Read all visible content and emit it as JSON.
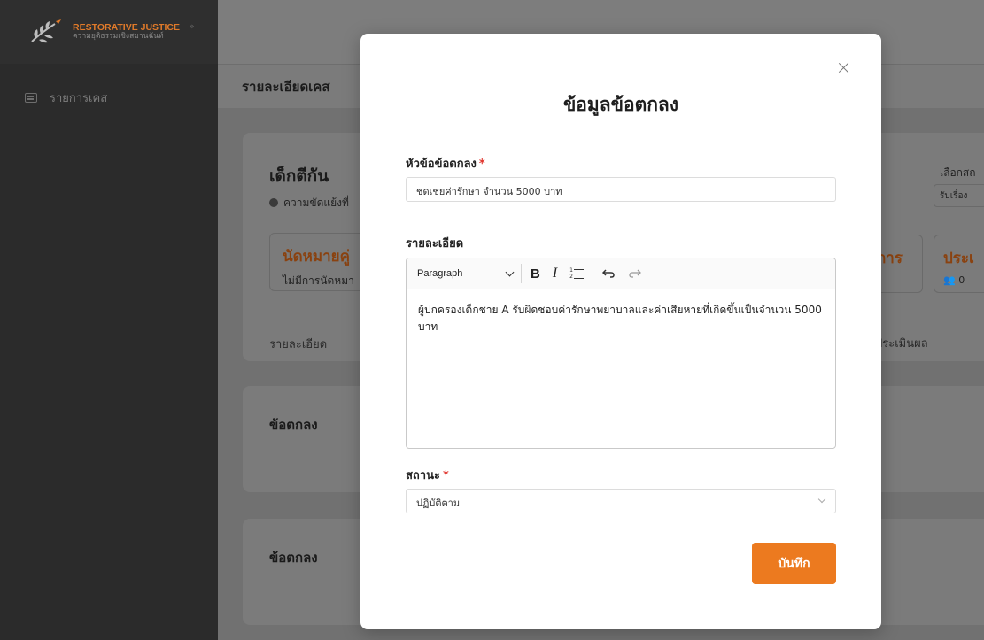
{
  "sidebar": {
    "logo": {
      "title": "RESTORATIVE JUSTICE",
      "subtitle": "ความยุติธรรมเชิงสมานฉันท์"
    },
    "items": [
      {
        "label": "รายการเคส",
        "icon": "list-icon"
      }
    ]
  },
  "header": {
    "page_title": "รายละเอียดเคส"
  },
  "background": {
    "case_title": "เด็กตีกัน",
    "case_subtitle": "ความขัดแย้งที่",
    "appointment_title": "นัดหมายคู่",
    "appointment_sub": "ไม่มีการนัดหมา",
    "detail_tab": "รายละเอียด",
    "agreement_title_1": "ข้อตกลง",
    "agreement_title_2": "ข้อตกลง",
    "right_select_label": "เลือกสถ",
    "right_select_value": "รับเรื่อง",
    "right_box_1": "การ",
    "right_box_2_title": "ประเ",
    "right_box_2_count": "0",
    "right_tab": "ประเมินผล"
  },
  "modal": {
    "title": "ข้อมูลข้อตกลง",
    "topic_label": "หัวข้อข้อตกลง",
    "required_mark": "*",
    "topic_value": "ชดเชยค่ารักษา จำนวน 5000 บาท",
    "detail_label": "รายละเอียด",
    "editor": {
      "format": "Paragraph",
      "bold": "B",
      "italic": "I",
      "content": "ผู้ปกครองเด็กชาย A รับผิดชอบค่ารักษาพยาบาลและค่าเสียหายที่เกิดขึ้นเป็นจำนวน 5000 บาท"
    },
    "status_label": "สถานะ",
    "status_value": "ปฏิบัติตาม",
    "save_label": "บันทึก"
  },
  "colors": {
    "accent": "#ec7a1f",
    "required": "#e0342c",
    "sidebar": "#2b2b2b"
  }
}
